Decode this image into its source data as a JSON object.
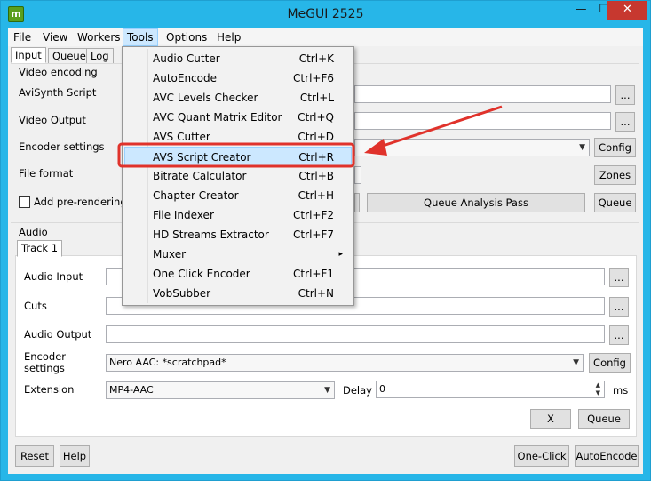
{
  "window": {
    "title": "MeGUI 2525",
    "icon": "megui-app-icon",
    "icon_glyph": "m",
    "controls": {
      "minimize": "—",
      "maximize": "☐",
      "close": "✕"
    },
    "close_color": "#c7382f",
    "frame_color": "#27b6e8"
  },
  "menubar": [
    "File",
    "View",
    "Workers",
    "Tools",
    "Options",
    "Help"
  ],
  "tabs": [
    "Input",
    "Queue",
    "Log"
  ],
  "video": {
    "group_label": "Video encoding",
    "avisynth_label": "AviSynth Script",
    "output_label": "Video Output",
    "encoder_label": "Encoder settings",
    "format_label": "File format",
    "prerender_label": "Add pre-rendering jo",
    "browse": "...",
    "config": "Config",
    "zones": "Zones",
    "queue_analysis": "Queue Analysis Pass",
    "queue": "Queue"
  },
  "audio": {
    "group_label": "Audio",
    "track_tab": "Track 1",
    "input_label": "Audio Input",
    "cuts_label": "Cuts",
    "output_label": "Audio Output",
    "encoder_label_1": "Encoder",
    "encoder_label_2": "settings",
    "encoder_value": "Nero AAC: *scratchpad*",
    "extension_label": "Extension",
    "extension_value": "MP4-AAC",
    "delay_label": "Delay",
    "delay_value": "0",
    "delay_unit": "ms",
    "config": "Config",
    "browse": "...",
    "x_button": "X",
    "queue": "Queue"
  },
  "footer": {
    "reset": "Reset",
    "help": "Help",
    "one_click": "One-Click",
    "autoencode": "AutoEncode"
  },
  "tools_menu": {
    "highlight_color": "#cce8ff",
    "items": [
      {
        "label": "Audio Cutter",
        "shortcut": "Ctrl+K"
      },
      {
        "label": "AutoEncode",
        "shortcut": "Ctrl+F6"
      },
      {
        "label": "AVC Levels Checker",
        "shortcut": "Ctrl+L"
      },
      {
        "label": "AVC Quant Matrix Editor",
        "shortcut": "Ctrl+Q"
      },
      {
        "label": "AVS Cutter",
        "shortcut": "Ctrl+D"
      },
      {
        "label": "AVS Script Creator",
        "shortcut": "Ctrl+R"
      },
      {
        "label": "Bitrate Calculator",
        "shortcut": "Ctrl+B"
      },
      {
        "label": "Chapter Creator",
        "shortcut": "Ctrl+H"
      },
      {
        "label": "File Indexer",
        "shortcut": "Ctrl+F2"
      },
      {
        "label": "HD Streams Extractor",
        "shortcut": "Ctrl+F7"
      },
      {
        "label": "Muxer",
        "shortcut": ""
      },
      {
        "label": "One Click Encoder",
        "shortcut": "Ctrl+F1"
      },
      {
        "label": "VobSubber",
        "shortcut": "Ctrl+N"
      }
    ],
    "submenu_arrow": "▸"
  },
  "annotation": {
    "color": "#e0322b"
  }
}
